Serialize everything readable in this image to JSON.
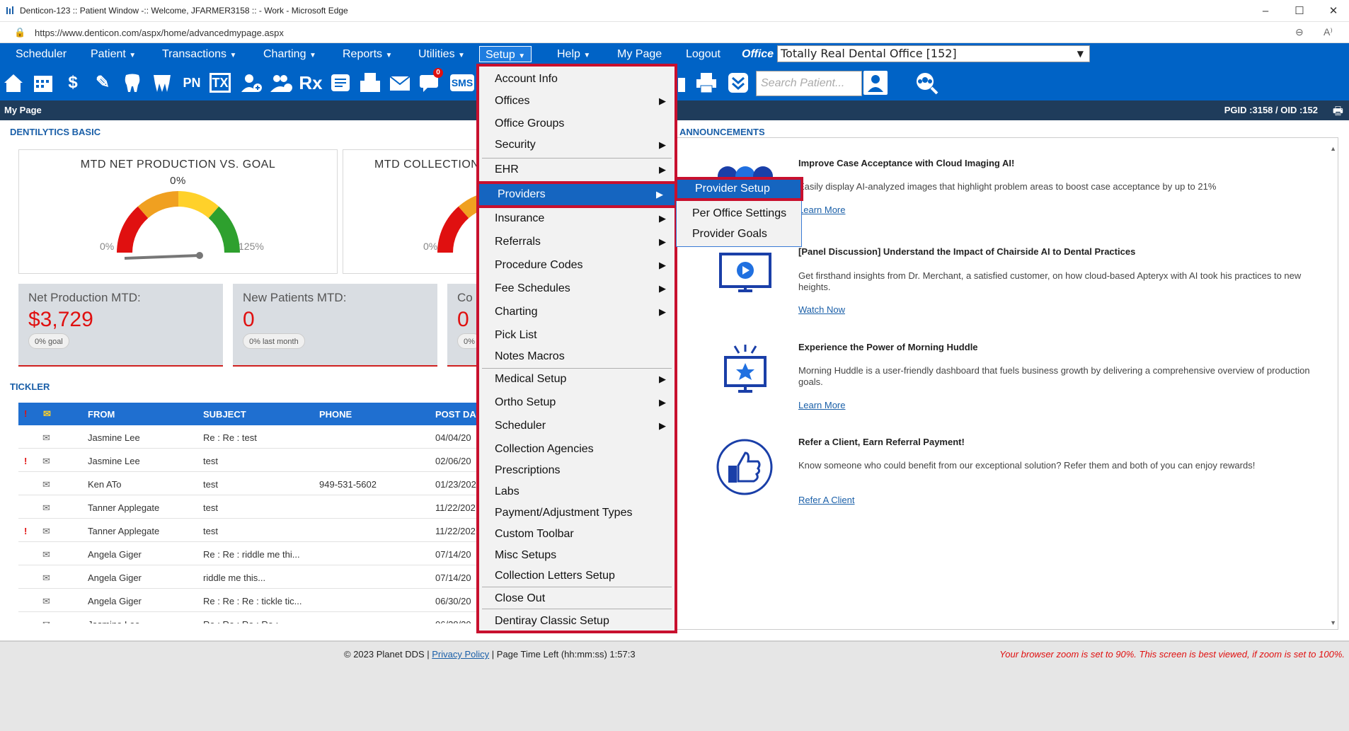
{
  "window": {
    "title": "Denticon-123 :: Patient Window -:: Welcome, JFARMER3158 :: - Work - Microsoft Edge",
    "url": "https://www.denticon.com/aspx/home/advancedmypage.aspx"
  },
  "nav": {
    "items": [
      "Scheduler",
      "Patient",
      "Transactions",
      "Charting",
      "Reports",
      "Utilities",
      "Setup",
      "Help",
      "My Page",
      "Logout"
    ],
    "office_label": "Office",
    "office_value": "Totally Real Dental Office [152]"
  },
  "toolbar": {
    "search_placeholder": "Search Patient...",
    "rx_badge": "0",
    "sms_label": "SMS",
    "pn_label": "PN",
    "tx_label": "TX",
    "rx_label": "Rx"
  },
  "page_header": {
    "title": "My Page",
    "ids": "PGID :3158  /  OID :152"
  },
  "dentilytics": {
    "title": "DENTILYTICS BASIC",
    "card1": {
      "title": "MTD NET PRODUCTION VS. GOAL",
      "percent": "0%",
      "min": "0%",
      "max": "125%"
    },
    "card2": {
      "title": "MTD COLLECTION",
      "min": "0%"
    },
    "stats": [
      {
        "label": "Net Production MTD:",
        "value": "$3,729",
        "pill": "0% goal"
      },
      {
        "label": "New Patients MTD:",
        "value": "0",
        "pill": "0% last month"
      },
      {
        "label": "Co",
        "value": "0",
        "pill": "0%"
      }
    ]
  },
  "tickler": {
    "title": "TICKLER",
    "columns": [
      "FROM",
      "SUBJECT",
      "PHONE",
      "POST DA"
    ],
    "rows": [
      {
        "flag": "",
        "from": "Jasmine Lee",
        "subject": "Re : Re : test",
        "phone": "",
        "date": "04/04/20"
      },
      {
        "flag": "!",
        "from": "Jasmine Lee",
        "subject": "test",
        "phone": "",
        "date": "02/06/20"
      },
      {
        "flag": "",
        "from": "Ken ATo",
        "subject": "test",
        "phone": "949-531-5602",
        "date": "01/23/202"
      },
      {
        "flag": "",
        "from": "Tanner Applegate",
        "subject": "test",
        "phone": "",
        "date": "11/22/202"
      },
      {
        "flag": "!",
        "from": "Tanner Applegate",
        "subject": "test",
        "phone": "",
        "date": "11/22/202"
      },
      {
        "flag": "",
        "from": "Angela Giger",
        "subject": "Re : Re : riddle me thi...",
        "phone": "",
        "date": "07/14/20"
      },
      {
        "flag": "",
        "from": "Angela Giger",
        "subject": "riddle me this...",
        "phone": "",
        "date": "07/14/20"
      },
      {
        "flag": "",
        "from": "Angela Giger",
        "subject": "Re : Re : Re : tickle tic...",
        "phone": "",
        "date": "06/30/20"
      },
      {
        "flag": "",
        "from": "Jasmine Lee",
        "subject": "Re : Re : Re : Re :",
        "phone": "",
        "date": "06/28/20"
      }
    ]
  },
  "announcements": {
    "title": "ANNOUNCEMENTS",
    "items": [
      {
        "title": "Improve Case Acceptance with Cloud Imaging AI!",
        "body": "Easily display AI-analyzed images that highlight problem areas to boost case acceptance by up to 21%",
        "link": "Learn More"
      },
      {
        "title": "[Panel Discussion] Understand the Impact of Chairside AI to Dental Practices",
        "body": "Get firsthand insights from Dr. Merchant, a satisfied customer, on how cloud-based Apteryx with AI took his practices to new heights.",
        "link": "Watch Now"
      },
      {
        "title": "Experience the Power of Morning Huddle",
        "body": "Morning Huddle is a user-friendly dashboard that fuels business growth by delivering a comprehensive overview of production goals.",
        "link": "Learn More"
      },
      {
        "title": "Refer a Client, Earn Referral Payment!",
        "body": "Know someone who could benefit from our exceptional solution? Refer them and both of you can enjoy rewards!",
        "link": "Refer A Client"
      }
    ]
  },
  "setup_menu": {
    "items": [
      "Account Info",
      "Offices",
      "Office Groups",
      "Security",
      "EHR",
      "Providers",
      "Insurance",
      "Referrals",
      "Procedure Codes",
      "Fee Schedules",
      "Charting",
      "Pick List",
      "Notes Macros",
      "Medical Setup",
      "Ortho Setup",
      "Scheduler",
      "Collection Agencies",
      "Prescriptions",
      "Labs",
      "Payment/Adjustment Types",
      "Custom Toolbar",
      "Misc Setups",
      "Collection Letters Setup",
      "Close Out",
      "Dentiray Classic Setup"
    ]
  },
  "providers_submenu": {
    "items": [
      "Provider Setup",
      "Per Office Settings",
      "Provider Goals"
    ]
  },
  "footer": {
    "copyright": "© 2023 Planet DDS | ",
    "privacy": "Privacy Policy",
    "time_left": " |  Page Time Left (hh:mm:ss) 1:57:3",
    "zoom_warning": "Your browser zoom is set to 90%. This screen is best viewed, if zoom is set to 100%."
  },
  "colors": {
    "nav": "#0063c6",
    "highlight": "#1565c0",
    "outline": "#c8102e",
    "accent_red": "#e01010"
  }
}
